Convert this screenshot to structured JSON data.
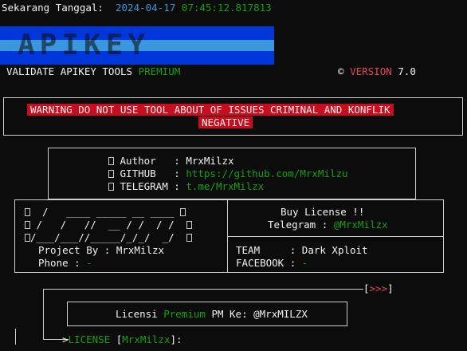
{
  "header": {
    "date_label": "Sekarang Tanggal:",
    "date_value": "2024-04-17",
    "time_value": "07:45:12.817813"
  },
  "banner": {
    "text": "APIKEY",
    "color_dark": "#0037da",
    "color_light": "#3a96dd"
  },
  "subtitle": {
    "tools_label": "VALIDATE APIKEY TOOLS",
    "tools_tag": "PREMIUM",
    "copyright": "©",
    "version_label": "VERSION",
    "version_number": "7.0"
  },
  "warning": {
    "line1": "WARNING DO NOT USE TOOL ABOUT OF ISSUES CRIMINAL AND KONFLIK",
    "line2": "NEGATIVE",
    "color": "#c50f1f"
  },
  "info": {
    "author_label": "Author   :",
    "author_value": "MrxMilzx",
    "github_label": "GITHUB   :",
    "github_value": "https://github.com/MrxMilzu",
    "telegram_label": "TELEGRAM :",
    "telegram_value": "t.me/MrxMilzx"
  },
  "left_panel": {
    "art_line1": "  /   ____ _____ __ ____ ",
    "art_line2": " /   /   //  __ / /  / /  ",
    "art_line3": "/___/___//_____/_/_/  _/  ",
    "project_label": "Project By :",
    "project_value": "MrxMilzx",
    "phone_label": "Phone :",
    "phone_value": "-"
  },
  "right_panel": {
    "buy_title": "Buy License !!",
    "telegram_label": "Telegram :",
    "telegram_value": "@MrxMilzx",
    "team_label": "TEAM     :",
    "team_value": "Dark Xploit",
    "facebook_label": "FACEBOOK :",
    "facebook_value": "-"
  },
  "license": {
    "arrow_open": "[",
    "arrow_glyphs": ">>>",
    "arrow_close": "]",
    "licensi_label": "Licensi",
    "licensi_tag": "Premium",
    "pm_label": "PM Ke:",
    "pm_value": "@MrxMILZX",
    "prompt_label": "LICENSE",
    "prompt_user": "MrxMilzx",
    "prompt_suffix": ":"
  }
}
